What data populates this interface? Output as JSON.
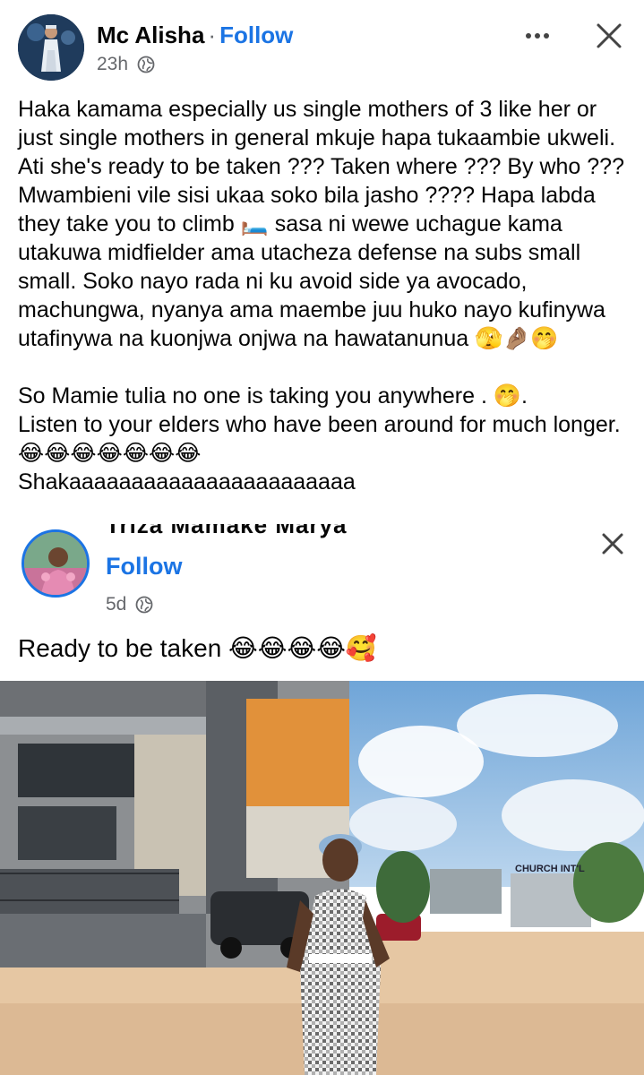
{
  "header": {
    "author": "Mc Alisha",
    "separator": "·",
    "follow_label": "Follow",
    "time": "23h",
    "privacy_icon": "globe-icon",
    "more_icon": "more-horizontal-icon",
    "close_icon": "close-icon"
  },
  "post": {
    "paragraph1": "Haka kamama especially us single mothers of 3 like her or just single mothers in general mkuje hapa tukaambie ukweli. Ati she's ready to be taken ??? Taken where ??? By who ??? Mwambieni vile sisi ukaa soko bila jasho ????  Hapa labda they take you to climb 🛏️ sasa ni wewe uchague kama utakuwa midfielder ama utacheza defense na subs small small. Soko nayo rada ni ku avoid side ya avocado, machungwa, nyanya ama maembe juu huko nayo kufinywa utafinywa na kuonjwa onjwa na hawatanunua 🫣🤌🏽🤭",
    "paragraph2": "So Mamie tulia no one is taking you anywhere . 🤭.\nListen to your elders who have been around for much longer. 😂😂😂😂😂😂😂\nShakaaaaaaaaaaaaaaaaaaaaaaa"
  },
  "shared": {
    "author": "Triza Mamake Marya",
    "follow_label": "Follow",
    "time": "5d",
    "caption": "Ready to  be taken 😂😂😂😂🥰",
    "signboard": "CHURCH INT'L",
    "colors": {
      "follow": "#1b74e4",
      "muted": "#65676b"
    }
  }
}
